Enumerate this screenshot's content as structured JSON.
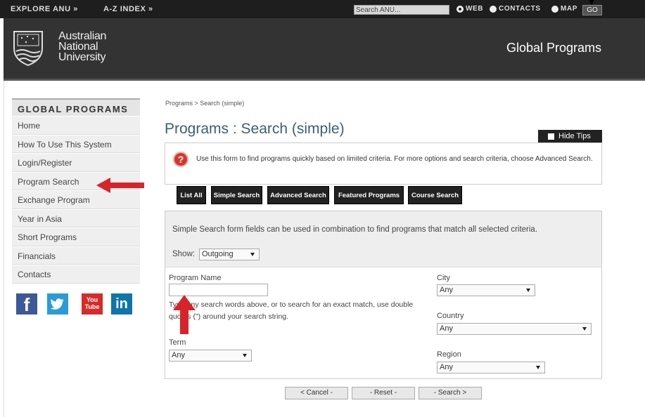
{
  "topbar": {
    "explore": "EXPLORE ANU »",
    "az_index": "A-Z INDEX »",
    "search_placeholder": "Search ANU...",
    "radio_web": "WEB",
    "radio_contacts": "CONTACTS",
    "radio_map": "MAP",
    "go": "GO"
  },
  "header": {
    "logo_line1": "Australian",
    "logo_line2": "National",
    "logo_line3": "University",
    "site_title": "Global Programs"
  },
  "sidebar": {
    "title": "GLOBAL PROGRAMS",
    "items": [
      {
        "label": "Home"
      },
      {
        "label": "How To Use This System"
      },
      {
        "label": "Login/Register"
      },
      {
        "label": "Program Search"
      },
      {
        "label": "Exchange Program"
      },
      {
        "label": "Year in Asia"
      },
      {
        "label": "Short Programs"
      },
      {
        "label": "Financials"
      },
      {
        "label": "Contacts"
      }
    ],
    "social": {
      "facebook": "f",
      "youtube_1": "You",
      "youtube_2": "Tube",
      "linkedin": "in"
    }
  },
  "main": {
    "breadcrumb": "Programs > Search (simple)",
    "title": "Programs : Search (simple)",
    "hide_tips": "Hide Tips",
    "tip_icon": "?",
    "tip": "Use this form to find programs quickly based on limited criteria. For more options and search criteria, choose Advanced Search.",
    "tabs": [
      {
        "label": "List All"
      },
      {
        "label": "Simple Search"
      },
      {
        "label": "Advanced Search"
      },
      {
        "label": "Featured Programs"
      },
      {
        "label": "Course Search"
      }
    ],
    "description": "Simple Search form fields can be used in combination to find programs that match all selected criteria.",
    "show_label": "Show:",
    "show_value": "Outgoing",
    "program_name_label": "Program Name",
    "program_name_value": "",
    "help_text": "Type any search words above, or to search for an exact match, use double quotes (\") around your search string.",
    "term_label": "Term",
    "term_value": "Any",
    "city_label": "City",
    "city_value": "Any",
    "country_label": "Country",
    "country_value": "Any",
    "region_label": "Region",
    "region_value": "Any",
    "cancel": "< Cancel -",
    "reset": "- Reset -",
    "search": "- Search >"
  },
  "colors": {
    "header_bg": "#333333",
    "title_blue": "#3a6073",
    "annotation_red": "#d8232a"
  }
}
